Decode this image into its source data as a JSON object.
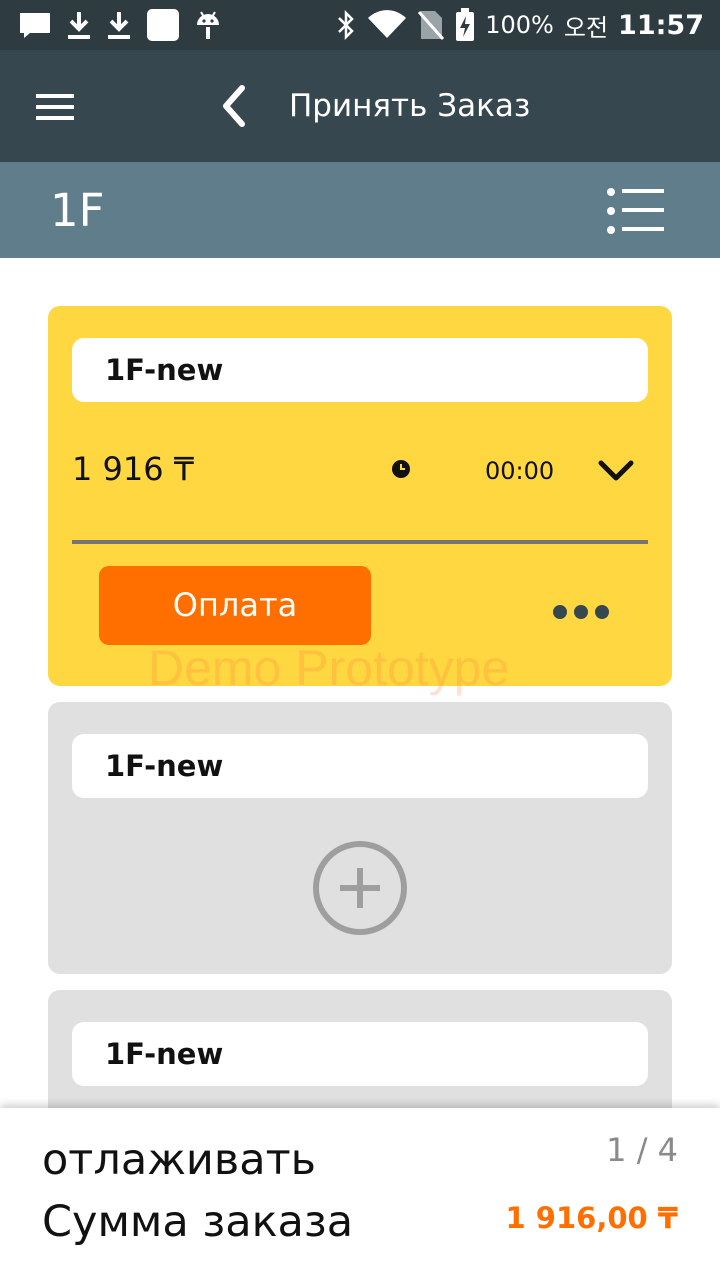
{
  "status_bar": {
    "left_icons": [
      "message-icon",
      "download-icon",
      "download-icon",
      "app-square-icon",
      "android-icon"
    ],
    "right_icons": [
      "bluetooth-icon",
      "wifi-icon",
      "no-sim-icon",
      "battery-charging-icon"
    ],
    "battery": "100%",
    "ampm": "오전",
    "time": "11:57"
  },
  "app_bar": {
    "title": "Принять Заказ",
    "menu_icon": "hamburger-icon",
    "back_icon": "back-arrow-icon"
  },
  "sub_bar": {
    "table_name": "1F",
    "list_icon": "list-icon"
  },
  "orders": [
    {
      "name": "1F-new",
      "amount": "1 916 ₸",
      "time": "00:00",
      "pay_label": "Оплата",
      "active": true
    },
    {
      "name": "1F-new",
      "active": false
    },
    {
      "name": "1F-new",
      "active": false
    }
  ],
  "watermark": "Demo Prototype",
  "footer": {
    "mode": "отлаживать",
    "page": "1 / 4",
    "sum_label": "Сумма заказа",
    "sum_value": "1 916,00 ₸"
  },
  "colors": {
    "status_bar": "#2e3b41",
    "app_bar": "#37474f",
    "sub_bar": "#607d8b",
    "active_card": "#ffd740",
    "inactive_card": "#e0e0e0",
    "accent": "#ff6f00"
  }
}
